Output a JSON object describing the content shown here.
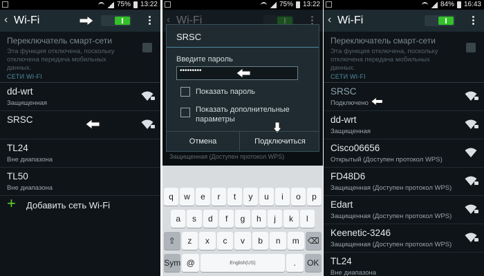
{
  "status1": {
    "battery": "75%",
    "time": "13:22"
  },
  "status2": {
    "battery": "75%",
    "time": "13:22"
  },
  "status3": {
    "battery": "84%",
    "time": "16:43"
  },
  "title": "Wi-Fi",
  "smart": {
    "title": "Переключатель смарт-сети",
    "desc": "Эта функция отключена, поскольку отключена передача мобильных данных."
  },
  "section": "СЕТИ WI-FI",
  "panel1_networks": [
    {
      "name": "dd-wrt",
      "status": "Защищенная"
    },
    {
      "name": "SRSC",
      "status": ""
    },
    {
      "name": "TL24",
      "status": "Вне диапазона"
    },
    {
      "name": "TL50",
      "status": "Вне диапазона"
    }
  ],
  "add_network": "Добавить сеть Wi-Fi",
  "dialog": {
    "title": "SRSC",
    "password_label": "Введите пароль",
    "password_value": "•••••••••",
    "show_password": "Показать пароль",
    "show_advanced": "Показать дополнительные параметры",
    "cancel": "Отмена",
    "connect": "Подключиться"
  },
  "under_dialog": "Защищенная (Доступен протокол WPS)",
  "keyboard": {
    "row1": [
      "q",
      "w",
      "e",
      "r",
      "t",
      "y",
      "u",
      "i",
      "o",
      "p"
    ],
    "row2": [
      "a",
      "s",
      "d",
      "f",
      "g",
      "h",
      "j",
      "k",
      "l"
    ],
    "row3": [
      "⇧",
      "z",
      "x",
      "c",
      "v",
      "b",
      "n",
      "m",
      "⌫"
    ],
    "row4": [
      "Sym",
      "@",
      "English(US)",
      ".",
      "OK"
    ]
  },
  "panel3_networks": [
    {
      "name": "SRSC",
      "status": "Подключено"
    },
    {
      "name": "dd-wrt",
      "status": "Защищенная"
    },
    {
      "name": "Cisco06656",
      "status": "Открытый (Доступен протокол WPS)"
    },
    {
      "name": "FD48D6",
      "status": "Защищенная (Доступен протокол WPS)"
    },
    {
      "name": "Edart",
      "status": "Защищенная (Доступен протокол WPS)"
    },
    {
      "name": "Keenetic-3246",
      "status": "Защищенная (Доступен протокол WPS)"
    },
    {
      "name": "TL24",
      "status": "Вне диапазона"
    }
  ],
  "colors": {
    "accent": "#34c02a",
    "arrow": "#ffffff",
    "section": "#4f8aa2"
  }
}
